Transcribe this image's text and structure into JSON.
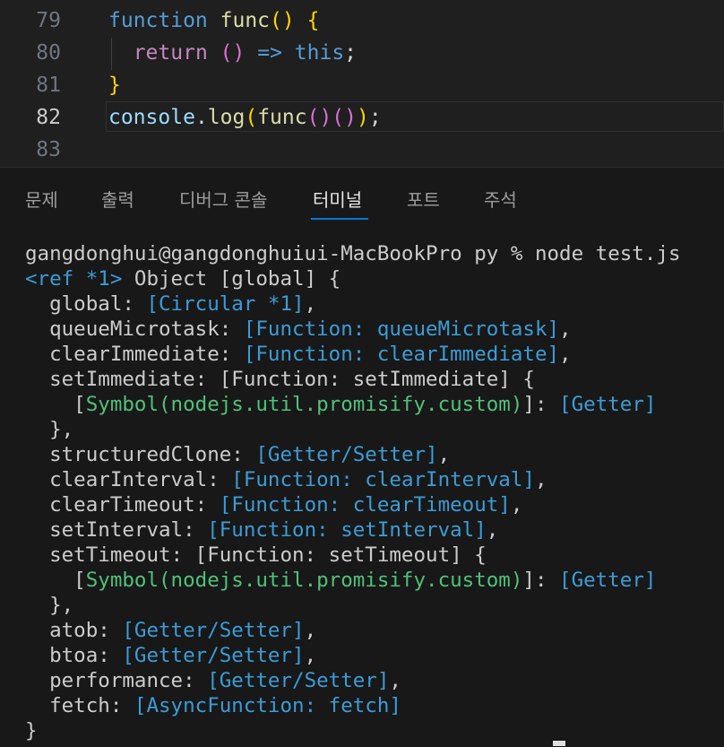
{
  "editor": {
    "lines": [
      {
        "num": "79",
        "parts": [
          [
            "kw",
            "function"
          ],
          [
            "",
            " "
          ],
          [
            "fn",
            "func"
          ],
          [
            "br1",
            "()"
          ],
          [
            "",
            " "
          ],
          [
            "br1",
            "{"
          ]
        ]
      },
      {
        "num": "80",
        "parts": [
          [
            "",
            "  "
          ],
          [
            "ret",
            "return"
          ],
          [
            "",
            " "
          ],
          [
            "br2",
            "()"
          ],
          [
            "",
            " "
          ],
          [
            "arrow",
            "=>"
          ],
          [
            "",
            " "
          ],
          [
            "kw",
            "this"
          ],
          [
            "",
            ";"
          ]
        ]
      },
      {
        "num": "81",
        "parts": [
          [
            "br1",
            "}"
          ]
        ]
      },
      {
        "num": "82",
        "parts": [
          [
            "var",
            "console"
          ],
          [
            "",
            "."
          ],
          [
            "fn",
            "log"
          ],
          [
            "br1",
            "("
          ],
          [
            "fn",
            "func"
          ],
          [
            "br2",
            "()"
          ],
          [
            "br2",
            "()"
          ],
          [
            "br1",
            ")"
          ],
          [
            "",
            ";"
          ]
        ]
      },
      {
        "num": "83",
        "parts": []
      }
    ],
    "active_line": "82"
  },
  "panel": {
    "tabs": [
      {
        "label": "문제",
        "active": false
      },
      {
        "label": "출력",
        "active": false
      },
      {
        "label": "디버그 콘솔",
        "active": false
      },
      {
        "label": "터미널",
        "active": true
      },
      {
        "label": "포트",
        "active": false
      },
      {
        "label": "주석",
        "active": false
      }
    ]
  },
  "terminal": {
    "lines": [
      [
        [
          "",
          "gangdonghui@gangdonghuiui-MacBookPro py % node test.js"
        ]
      ],
      [
        [
          "cyan",
          "<ref *1>"
        ],
        [
          "",
          " Object [global] {"
        ]
      ],
      [
        [
          "",
          "  global: "
        ],
        [
          "cyan",
          "[Circular *1]"
        ],
        [
          "",
          ","
        ]
      ],
      [
        [
          "",
          "  queueMicrotask: "
        ],
        [
          "cyan",
          "[Function: queueMicrotask]"
        ],
        [
          "",
          ","
        ]
      ],
      [
        [
          "",
          "  clearImmediate: "
        ],
        [
          "cyan",
          "[Function: clearImmediate]"
        ],
        [
          "",
          ","
        ]
      ],
      [
        [
          "",
          "  setImmediate: [Function: setImmediate] {"
        ]
      ],
      [
        [
          "",
          "    ["
        ],
        [
          "green",
          "Symbol(nodejs.util.promisify.custom)"
        ],
        [
          "",
          "]: "
        ],
        [
          "cyan",
          "[Getter]"
        ]
      ],
      [
        [
          "",
          "  },"
        ]
      ],
      [
        [
          "",
          "  structuredClone: "
        ],
        [
          "cyan",
          "[Getter/Setter]"
        ],
        [
          "",
          ","
        ]
      ],
      [
        [
          "",
          "  clearInterval: "
        ],
        [
          "cyan",
          "[Function: clearInterval]"
        ],
        [
          "",
          ","
        ]
      ],
      [
        [
          "",
          "  clearTimeout: "
        ],
        [
          "cyan",
          "[Function: clearTimeout]"
        ],
        [
          "",
          ","
        ]
      ],
      [
        [
          "",
          "  setInterval: "
        ],
        [
          "cyan",
          "[Function: setInterval]"
        ],
        [
          "",
          ","
        ]
      ],
      [
        [
          "",
          "  setTimeout: [Function: setTimeout] {"
        ]
      ],
      [
        [
          "",
          "    ["
        ],
        [
          "green",
          "Symbol(nodejs.util.promisify.custom)"
        ],
        [
          "",
          "]: "
        ],
        [
          "cyan",
          "[Getter]"
        ]
      ],
      [
        [
          "",
          "  },"
        ]
      ],
      [
        [
          "",
          "  atob: "
        ],
        [
          "cyan",
          "[Getter/Setter]"
        ],
        [
          "",
          ","
        ]
      ],
      [
        [
          "",
          "  btoa: "
        ],
        [
          "cyan",
          "[Getter/Setter]"
        ],
        [
          "",
          ","
        ]
      ],
      [
        [
          "",
          "  performance: "
        ],
        [
          "cyan",
          "[Getter/Setter]"
        ],
        [
          "",
          ","
        ]
      ],
      [
        [
          "",
          "  fetch: "
        ],
        [
          "cyan",
          "[AsyncFunction: fetch]"
        ]
      ],
      [
        [
          "",
          "}"
        ]
      ]
    ]
  }
}
